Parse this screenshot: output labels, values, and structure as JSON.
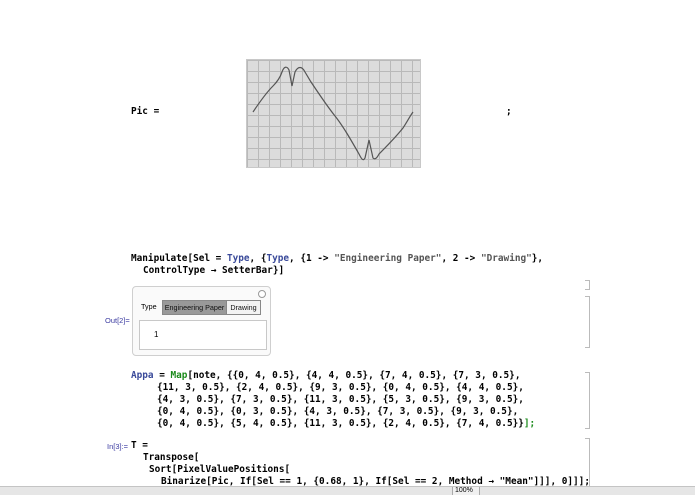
{
  "cell1": {
    "pic_label": "Pic =",
    "semicolon": ";"
  },
  "cell2": {
    "line1_a": "Manipulate[Sel = ",
    "line1_b": "Type",
    "line1_c": ", {",
    "line1_d": "Type",
    "line1_e": ", {1 -> ",
    "line1_f": "\"Engineering Paper\"",
    "line1_g": ", 2 -> ",
    "line1_h": "\"Drawing\"",
    "line1_i": "},",
    "line2": "ControlType → SetterBar}]"
  },
  "output2": {
    "label": "Out[2]=",
    "type_label": "Type",
    "option1": "Engineering Paper",
    "option2": "Drawing",
    "value": "1",
    "selected_color": "#999999"
  },
  "cell3": {
    "line1_a": "Appa",
    "line1_b": " = ",
    "line1_c": "Map",
    "line1_d": "[note, {{0, 4, 0.5}, {4, 4, 0.5}, {7, 4, 0.5}, {7, 3, 0.5},",
    "line2": "{11, 3, 0.5}, {2, 4, 0.5}, {9, 3, 0.5}, {0, 4, 0.5}, {4, 4, 0.5},",
    "line3": "{4, 3, 0.5}, {7, 3, 0.5}, {11, 3, 0.5}, {5, 3, 0.5}, {9, 3, 0.5},",
    "line4": "{0, 4, 0.5}, {0, 3, 0.5}, {4, 3, 0.5}, {7, 3, 0.5}, {9, 3, 0.5},",
    "line5_a": "{0, 4, 0.5}, {5, 4, 0.5}, {11, 3, 0.5}, {2, 4, 0.5}, {7, 4, 0.5}}",
    "line5_b": "];"
  },
  "cell4": {
    "label": "In[3]:=",
    "line1": "T =",
    "line2": "Transpose[",
    "line3": "Sort[PixelValuePositions[",
    "line4": "Binarize[Pic, If[Sel == 1, {0.68, 1}, If[Sel == 2, Method → \"Mean\"]]], 0]]];"
  },
  "statusbar": {
    "zoom": "100%"
  },
  "colors": {
    "symbol_blue": "#3a4a9a",
    "green_bracket": "#1a8a1a",
    "label_blue": "#3a3aa0"
  }
}
